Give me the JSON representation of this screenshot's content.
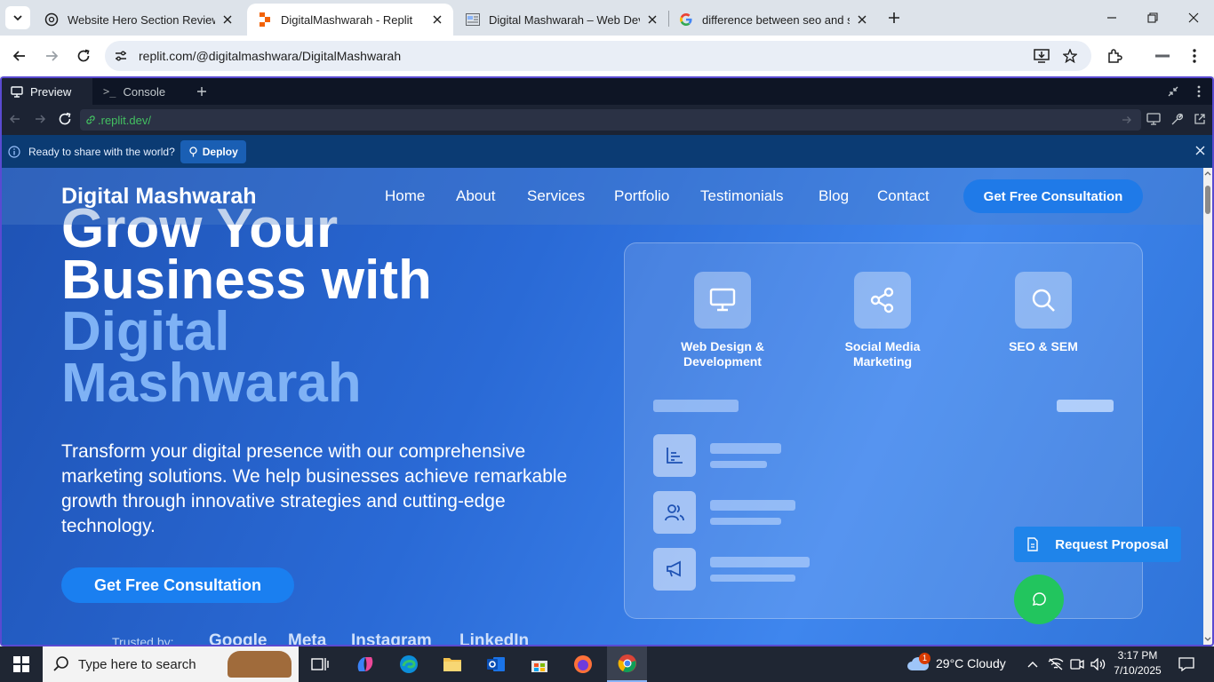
{
  "browser": {
    "tabs": [
      {
        "title": "Website Hero Section Review",
        "active": false
      },
      {
        "title": "DigitalMashwarah - Replit",
        "active": true
      },
      {
        "title": "Digital Mashwarah – Web Devel",
        "active": false
      },
      {
        "title": "difference between seo and sem",
        "active": false
      }
    ],
    "url": "replit.com/@digitalmashwara/DigitalMashwarah"
  },
  "replit": {
    "tabs": [
      {
        "label": "Preview",
        "icon": "preview-icon"
      },
      {
        "label": "Console",
        "icon": "terminal-icon"
      }
    ],
    "preview_url": ".replit.dev/",
    "deploy_message": "Ready to share with the world?",
    "deploy_label": "Deploy"
  },
  "site": {
    "logo": "Digital Mashwarah",
    "nav": [
      "Home",
      "About",
      "Services",
      "Portfolio",
      "Testimonials",
      "Blog",
      "Contact"
    ],
    "nav_cta": "Get Free Consultation",
    "hero": {
      "line1": "Grow Your",
      "line2": "Business with",
      "line3": "Digital",
      "line4": "Mashwarah",
      "subtitle": "Transform your digital presence with our comprehensive marketing solutions. We help businesses achieve remarkable growth through innovative strategies and cutting-edge technology.",
      "cta": "Get Free Consultation",
      "trusted_by": "Trusted by:",
      "brands": [
        "Google",
        "Meta",
        "Instagram",
        "LinkedIn"
      ]
    },
    "services": [
      {
        "label": "Web Design & Development",
        "icon": "monitor-icon"
      },
      {
        "label": "Social Media Marketing",
        "icon": "share-icon"
      },
      {
        "label": "SEO & SEM",
        "icon": "search-icon"
      }
    ],
    "request_proposal": "Request Proposal"
  },
  "taskbar": {
    "search_placeholder": "Type here to search",
    "weather": "29°C  Cloudy",
    "weather_badge": "1",
    "time": "3:17 PM",
    "date": "7/10/2025"
  },
  "colors": {
    "accent": "#1f7ae8",
    "replit_frame": "#5a4ad1",
    "whatsapp": "#22c55e",
    "highlight_text": "#7fb2f5"
  }
}
